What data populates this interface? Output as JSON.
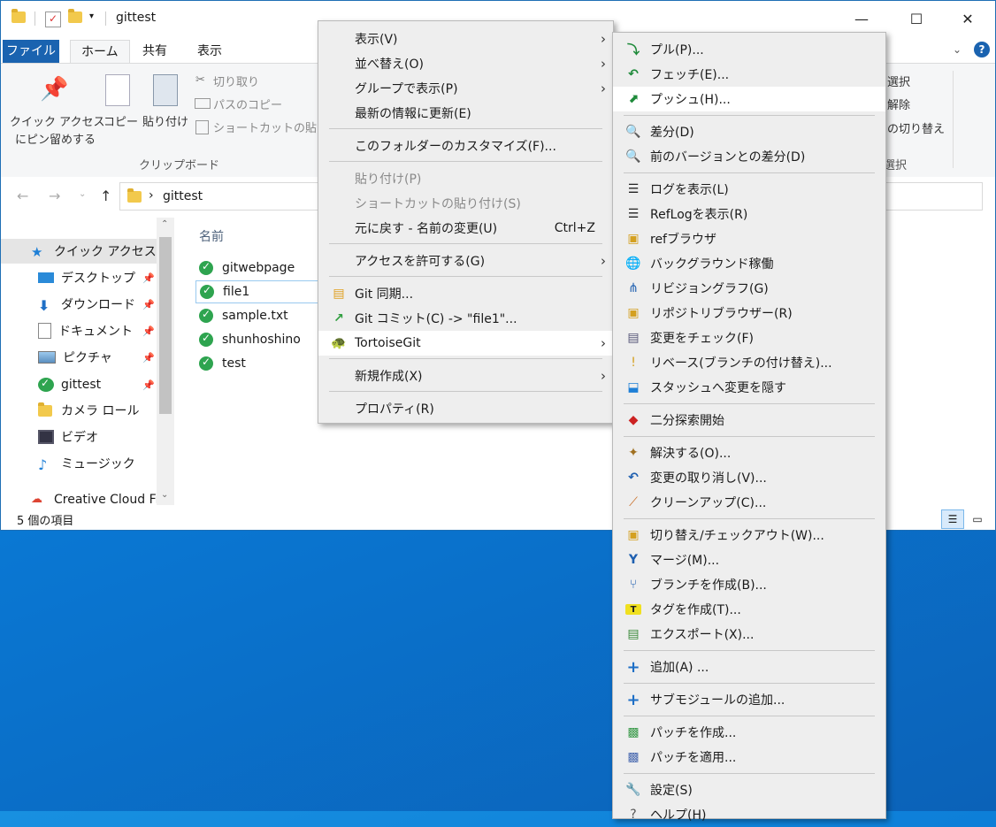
{
  "window": {
    "title": "gittest",
    "controls": {
      "minimize": "—",
      "maximize": "☐",
      "close": "✕"
    }
  },
  "ribbon": {
    "tabs": [
      "ファイル",
      "ホーム",
      "共有",
      "表示"
    ],
    "pin_label_line1": "クイック アクセス",
    "pin_label_line2": "にピン留めする",
    "copy_label": "コピー",
    "paste_label": "貼り付け",
    "cut_label": "切り取り",
    "copy_path_label": "パスのコピー",
    "paste_shortcut_label": "ショートカットの貼り付",
    "clipboard_group": "クリップボード",
    "right_select": "選択",
    "right_release": "解除",
    "right_toggle": "の切り替え",
    "right_group": "選択"
  },
  "address": {
    "path": "gittest",
    "arrow": "›"
  },
  "nav": {
    "items": [
      {
        "label": "クイック アクセス",
        "icon": "star-icon"
      },
      {
        "label": "デスクトップ",
        "icon": "desktop-icon",
        "pinned": true
      },
      {
        "label": "ダウンロード",
        "icon": "download-icon",
        "pinned": true
      },
      {
        "label": "ドキュメント",
        "icon": "document-icon",
        "pinned": true
      },
      {
        "label": "ピクチャ",
        "icon": "picture-icon",
        "pinned": true
      },
      {
        "label": "gittest",
        "icon": "git-folder-icon",
        "pinned": true
      },
      {
        "label": "カメラ ロール",
        "icon": "folder-icon"
      },
      {
        "label": "ビデオ",
        "icon": "video-icon"
      },
      {
        "label": "ミュージック",
        "icon": "music-icon"
      },
      {
        "label": "Creative Cloud File",
        "icon": "creative-cloud-icon"
      }
    ]
  },
  "files": {
    "header": "名前",
    "rows": [
      "gitwebpage",
      "file1",
      "sample.txt",
      "shunhoshino",
      "test"
    ]
  },
  "status": {
    "count": "5 個の項目"
  },
  "menu1": {
    "items": [
      {
        "label": "表示(V)",
        "submenu": true
      },
      {
        "label": "並べ替え(O)",
        "submenu": true
      },
      {
        "label": "グループで表示(P)",
        "submenu": true
      },
      {
        "label": "最新の情報に更新(E)"
      },
      {
        "label": "このフォルダーのカスタマイズ(F)..."
      },
      {
        "label": "貼り付け(P)",
        "disabled": true
      },
      {
        "label": "ショートカットの貼り付け(S)",
        "disabled": true
      },
      {
        "label": "元に戻す - 名前の変更(U)",
        "shortcut": "Ctrl+Z"
      },
      {
        "label": "アクセスを許可する(G)",
        "submenu": true
      },
      {
        "label": "Git 同期..."
      },
      {
        "label": "Git コミット(C) -> \"file1\"..."
      },
      {
        "label": "TortoiseGit",
        "submenu": true
      },
      {
        "label": "新規作成(X)",
        "submenu": true
      },
      {
        "label": "プロパティ(R)"
      }
    ]
  },
  "menu2": {
    "items": [
      {
        "label": "プル(P)...",
        "icon": "pull-icon"
      },
      {
        "label": "フェッチ(E)...",
        "icon": "fetch-icon"
      },
      {
        "label": "プッシュ(H)...",
        "icon": "push-icon"
      },
      {
        "label": "差分(D)",
        "icon": "diff-icon"
      },
      {
        "label": "前のバージョンとの差分(D)",
        "icon": "diff-prev-icon"
      },
      {
        "label": "ログを表示(L)",
        "icon": "log-icon"
      },
      {
        "label": "RefLogを表示(R)",
        "icon": "reflog-icon"
      },
      {
        "label": "refブラウザ",
        "icon": "ref-browser-icon"
      },
      {
        "label": "バックグラウンド稼働",
        "icon": "globe-icon"
      },
      {
        "label": "リビジョングラフ(G)",
        "icon": "revision-graph-icon"
      },
      {
        "label": "リポジトリブラウザー(R)",
        "icon": "repo-browser-icon"
      },
      {
        "label": "変更をチェック(F)",
        "icon": "check-changes-icon"
      },
      {
        "label": "リベース(ブランチの付け替え)...",
        "icon": "rebase-icon"
      },
      {
        "label": "スタッシュへ変更を隠す",
        "icon": "stash-icon"
      },
      {
        "label": "二分探索開始",
        "icon": "bisect-icon"
      },
      {
        "label": "解決する(O)...",
        "icon": "resolve-icon"
      },
      {
        "label": "変更の取り消し(V)...",
        "icon": "revert-icon"
      },
      {
        "label": "クリーンアップ(C)...",
        "icon": "cleanup-icon"
      },
      {
        "label": "切り替え/チェックアウト(W)...",
        "icon": "switch-icon"
      },
      {
        "label": "マージ(M)...",
        "icon": "merge-icon"
      },
      {
        "label": "ブランチを作成(B)...",
        "icon": "branch-icon"
      },
      {
        "label": "タグを作成(T)...",
        "icon": "tag-icon"
      },
      {
        "label": "エクスポート(X)...",
        "icon": "export-icon"
      },
      {
        "label": "追加(A) ...",
        "icon": "add-icon"
      },
      {
        "label": "サブモジュールの追加...",
        "icon": "submodule-add-icon"
      },
      {
        "label": "パッチを作成...",
        "icon": "create-patch-icon"
      },
      {
        "label": "パッチを適用...",
        "icon": "apply-patch-icon"
      },
      {
        "label": "設定(S)",
        "icon": "settings-icon"
      },
      {
        "label": "ヘルプ(H)",
        "icon": "help-icon"
      }
    ]
  }
}
